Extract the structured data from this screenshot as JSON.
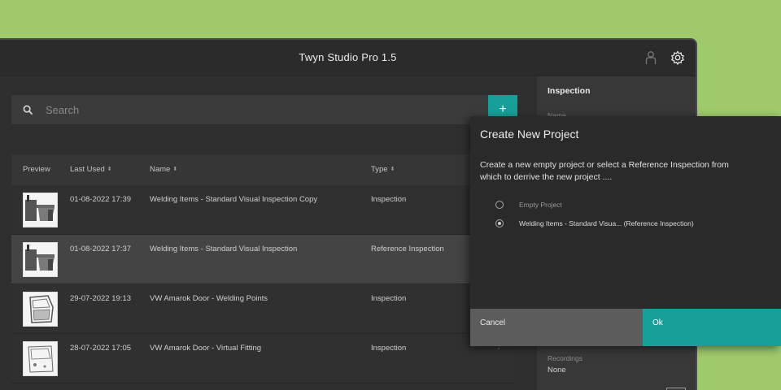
{
  "window": {
    "title": "Twyn Studio Pro 1.5"
  },
  "icons": {
    "user": "user-icon",
    "settings": "gear-icon",
    "search": "search-icon",
    "add": "plus-icon"
  },
  "search": {
    "placeholder": "Search"
  },
  "add_button": {
    "label": "+"
  },
  "table": {
    "headers": {
      "preview": "Preview",
      "last_used": "Last Used",
      "name": "Name",
      "type": "Type"
    },
    "rows": [
      {
        "date": "01-08-2022 17:39",
        "name": "Welding Items - Standard Visual Inspection Copy",
        "type": "Inspection"
      },
      {
        "date": "01-08-2022 17:37",
        "name": "Welding Items - Standard Visual Inspection",
        "type": "Reference Inspection"
      },
      {
        "date": "29-07-2022 19:13",
        "name": "VW Amarok Door - Welding Points",
        "type": "Inspection"
      },
      {
        "date": "28-07-2022 17:05",
        "name": "VW Amarok Door - Virtual Fitting",
        "type": "Inspection"
      }
    ]
  },
  "side_panel": {
    "heading": "Inspection",
    "name_label": "Name",
    "recordings_label": "Recordings",
    "recordings_value": "None"
  },
  "dialog": {
    "title": "Create New Project",
    "text": "Create a new empty project or select a Reference Inspection from which to derrive the new project ....",
    "options": [
      {
        "label": "Empty Project",
        "checked": false
      },
      {
        "label": "Welding Items - Standard Visua... (Reference Inspection)",
        "checked": true
      }
    ],
    "cancel": "Cancel",
    "ok": "Ok"
  },
  "colors": {
    "accent": "#17a09a",
    "background": "#9fca6c"
  }
}
